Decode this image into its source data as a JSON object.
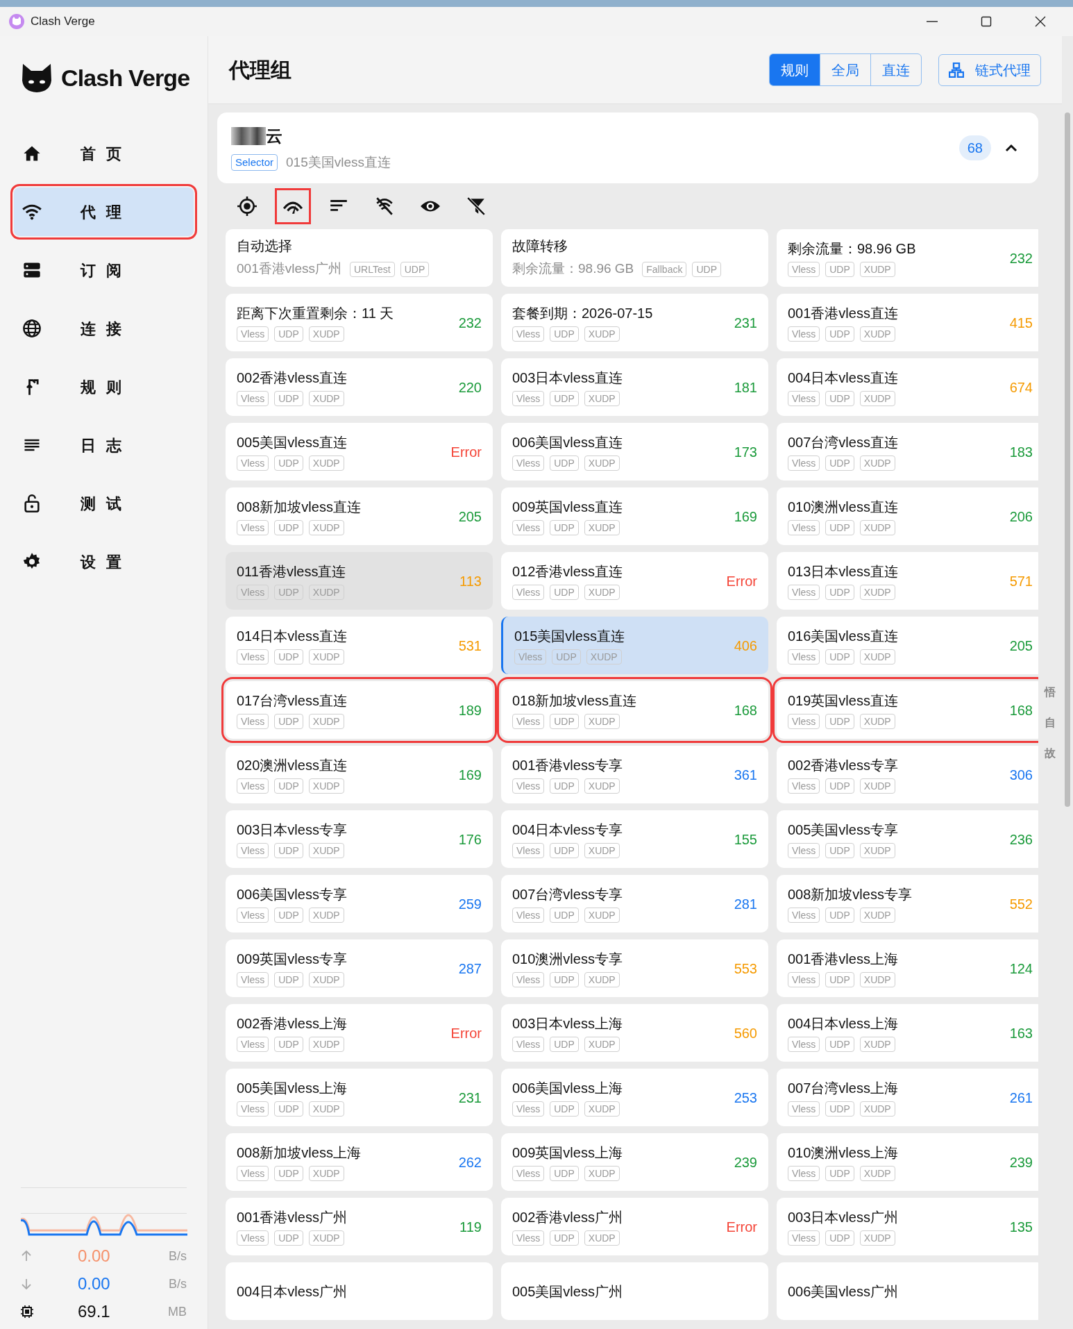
{
  "window": {
    "title": "Clash Verge"
  },
  "sidebar": {
    "logo": "Clash Verge",
    "items": [
      {
        "label": "首 页",
        "selected": false,
        "outlined": false
      },
      {
        "label": "代 理",
        "selected": true,
        "outlined": true
      },
      {
        "label": "订 阅",
        "selected": false,
        "outlined": false
      },
      {
        "label": "连 接",
        "selected": false,
        "outlined": false
      },
      {
        "label": "规 则",
        "selected": false,
        "outlined": false
      },
      {
        "label": "日 志",
        "selected": false,
        "outlined": false
      },
      {
        "label": "测 试",
        "selected": false,
        "outlined": false
      },
      {
        "label": "设 置",
        "selected": false,
        "outlined": false
      }
    ],
    "traffic": [
      {
        "kind": "up",
        "value": "0.00",
        "unit": "B/s"
      },
      {
        "kind": "down",
        "value": "0.00",
        "unit": "B/s"
      },
      {
        "kind": "memory",
        "value": "69.1",
        "unit": "MB"
      }
    ]
  },
  "header": {
    "title": "代理组",
    "modes": [
      {
        "label": "规则",
        "selected": true
      },
      {
        "label": "全局",
        "selected": false
      },
      {
        "label": "直连",
        "selected": false
      }
    ],
    "chain_button": "链式代理"
  },
  "group": {
    "title": "云",
    "type": "Selector",
    "current": "015美国vless直连",
    "count": "68",
    "expanded": true
  },
  "toolbar": [
    {
      "outlined": false
    },
    {
      "outlined": true
    },
    {
      "outlined": false
    },
    {
      "outlined": false
    },
    {
      "outlined": false
    },
    {
      "outlined": false
    }
  ],
  "proxies": [
    {
      "name": "自动选择",
      "subtitle": "001香港vless广州",
      "tags": [
        "URLTest",
        "UDP"
      ]
    },
    {
      "name": "故障转移",
      "subtitle": "剩余流量：98.96 GB",
      "tags": [
        "Fallback",
        "UDP"
      ]
    },
    {
      "name": "剩余流量：98.96 GB",
      "tags": [
        "Vless",
        "UDP",
        "XUDP"
      ],
      "delay": "232",
      "color": "#1a9a3a"
    },
    {
      "name": "距离下次重置剩余：11 天",
      "tags": [
        "Vless",
        "UDP",
        "XUDP"
      ],
      "delay": "232",
      "color": "#1a9a3a"
    },
    {
      "name": "套餐到期：2026-07-15",
      "tags": [
        "Vless",
        "UDP",
        "XUDP"
      ],
      "delay": "231",
      "color": "#1a9a3a"
    },
    {
      "name": "001香港vless直连",
      "tags": [
        "Vless",
        "UDP",
        "XUDP"
      ],
      "delay": "415",
      "color": "#f59a00"
    },
    {
      "name": "002香港vless直连",
      "tags": [
        "Vless",
        "UDP",
        "XUDP"
      ],
      "delay": "220",
      "color": "#1a9a3a"
    },
    {
      "name": "003日本vless直连",
      "tags": [
        "Vless",
        "UDP",
        "XUDP"
      ],
      "delay": "181",
      "color": "#1a9a3a"
    },
    {
      "name": "004日本vless直连",
      "tags": [
        "Vless",
        "UDP",
        "XUDP"
      ],
      "delay": "674",
      "color": "#f59a00"
    },
    {
      "name": "005美国vless直连",
      "tags": [
        "Vless",
        "UDP",
        "XUDP"
      ],
      "delay": "Error",
      "color": "#f44336"
    },
    {
      "name": "006美国vless直连",
      "tags": [
        "Vless",
        "UDP",
        "XUDP"
      ],
      "delay": "173",
      "color": "#1a9a3a"
    },
    {
      "name": "007台湾vless直连",
      "tags": [
        "Vless",
        "UDP",
        "XUDP"
      ],
      "delay": "183",
      "color": "#1a9a3a"
    },
    {
      "name": "008新加坡vless直连",
      "tags": [
        "Vless",
        "UDP",
        "XUDP"
      ],
      "delay": "205",
      "color": "#1a9a3a"
    },
    {
      "name": "009英国vless直连",
      "tags": [
        "Vless",
        "UDP",
        "XUDP"
      ],
      "delay": "169",
      "color": "#1a9a3a"
    },
    {
      "name": "010澳洲vless直连",
      "tags": [
        "Vless",
        "UDP",
        "XUDP"
      ],
      "delay": "206",
      "color": "#1a9a3a"
    },
    {
      "name": "011香港vless直连",
      "tags": [
        "Vless",
        "UDP",
        "XUDP"
      ],
      "delay": "113",
      "color": "#f59a00",
      "hovered": true
    },
    {
      "name": "012香港vless直连",
      "tags": [
        "Vless",
        "UDP",
        "XUDP"
      ],
      "delay": "Error",
      "color": "#f44336"
    },
    {
      "name": "013日本vless直连",
      "tags": [
        "Vless",
        "UDP",
        "XUDP"
      ],
      "delay": "571",
      "color": "#f59a00"
    },
    {
      "name": "014日本vless直连",
      "tags": [
        "Vless",
        "UDP",
        "XUDP"
      ],
      "delay": "531",
      "color": "#f59a00"
    },
    {
      "name": "015美国vless直连",
      "tags": [
        "Vless",
        "UDP",
        "XUDP"
      ],
      "delay": "406",
      "color": "#f59a00",
      "selected": true
    },
    {
      "name": "016美国vless直连",
      "tags": [
        "Vless",
        "UDP",
        "XUDP"
      ],
      "delay": "205",
      "color": "#1a9a3a"
    },
    {
      "name": "017台湾vless直连",
      "tags": [
        "Vless",
        "UDP",
        "XUDP"
      ],
      "delay": "189",
      "color": "#1a9a3a",
      "outlined": true
    },
    {
      "name": "018新加坡vless直连",
      "tags": [
        "Vless",
        "UDP",
        "XUDP"
      ],
      "delay": "168",
      "color": "#1a9a3a",
      "outlined": true
    },
    {
      "name": "019英国vless直连",
      "tags": [
        "Vless",
        "UDP",
        "XUDP"
      ],
      "delay": "168",
      "color": "#1a9a3a",
      "outlined": true
    },
    {
      "name": "020澳洲vless直连",
      "tags": [
        "Vless",
        "UDP",
        "XUDP"
      ],
      "delay": "169",
      "color": "#1a9a3a"
    },
    {
      "name": "001香港vless专享",
      "tags": [
        "Vless",
        "UDP",
        "XUDP"
      ],
      "delay": "361",
      "color": "#1976f0"
    },
    {
      "name": "002香港vless专享",
      "tags": [
        "Vless",
        "UDP",
        "XUDP"
      ],
      "delay": "306",
      "color": "#1976f0"
    },
    {
      "name": "003日本vless专享",
      "tags": [
        "Vless",
        "UDP",
        "XUDP"
      ],
      "delay": "176",
      "color": "#1a9a3a"
    },
    {
      "name": "004日本vless专享",
      "tags": [
        "Vless",
        "UDP",
        "XUDP"
      ],
      "delay": "155",
      "color": "#1a9a3a"
    },
    {
      "name": "005美国vless专享",
      "tags": [
        "Vless",
        "UDP",
        "XUDP"
      ],
      "delay": "236",
      "color": "#1a9a3a"
    },
    {
      "name": "006美国vless专享",
      "tags": [
        "Vless",
        "UDP",
        "XUDP"
      ],
      "delay": "259",
      "color": "#1976f0"
    },
    {
      "name": "007台湾vless专享",
      "tags": [
        "Vless",
        "UDP",
        "XUDP"
      ],
      "delay": "281",
      "color": "#1976f0"
    },
    {
      "name": "008新加坡vless专享",
      "tags": [
        "Vless",
        "UDP",
        "XUDP"
      ],
      "delay": "552",
      "color": "#f59a00"
    },
    {
      "name": "009英国vless专享",
      "tags": [
        "Vless",
        "UDP",
        "XUDP"
      ],
      "delay": "287",
      "color": "#1976f0"
    },
    {
      "name": "010澳洲vless专享",
      "tags": [
        "Vless",
        "UDP",
        "XUDP"
      ],
      "delay": "553",
      "color": "#f59a00"
    },
    {
      "name": "001香港vless上海",
      "tags": [
        "Vless",
        "UDP",
        "XUDP"
      ],
      "delay": "124",
      "color": "#1a9a3a"
    },
    {
      "name": "002香港vless上海",
      "tags": [
        "Vless",
        "UDP",
        "XUDP"
      ],
      "delay": "Error",
      "color": "#f44336"
    },
    {
      "name": "003日本vless上海",
      "tags": [
        "Vless",
        "UDP",
        "XUDP"
      ],
      "delay": "560",
      "color": "#f59a00"
    },
    {
      "name": "004日本vless上海",
      "tags": [
        "Vless",
        "UDP",
        "XUDP"
      ],
      "delay": "163",
      "color": "#1a9a3a"
    },
    {
      "name": "005美国vless上海",
      "tags": [
        "Vless",
        "UDP",
        "XUDP"
      ],
      "delay": "231",
      "color": "#1a9a3a"
    },
    {
      "name": "006美国vless上海",
      "tags": [
        "Vless",
        "UDP",
        "XUDP"
      ],
      "delay": "253",
      "color": "#1976f0"
    },
    {
      "name": "007台湾vless上海",
      "tags": [
        "Vless",
        "UDP",
        "XUDP"
      ],
      "delay": "261",
      "color": "#1976f0"
    },
    {
      "name": "008新加坡vless上海",
      "tags": [
        "Vless",
        "UDP",
        "XUDP"
      ],
      "delay": "262",
      "color": "#1976f0"
    },
    {
      "name": "009英国vless上海",
      "tags": [
        "Vless",
        "UDP",
        "XUDP"
      ],
      "delay": "239",
      "color": "#1a9a3a"
    },
    {
      "name": "010澳洲vless上海",
      "tags": [
        "Vless",
        "UDP",
        "XUDP"
      ],
      "delay": "239",
      "color": "#1a9a3a"
    },
    {
      "name": "001香港vless广州",
      "tags": [
        "Vless",
        "UDP",
        "XUDP"
      ],
      "delay": "119",
      "color": "#1a9a3a"
    },
    {
      "name": "002香港vless广州",
      "tags": [
        "Vless",
        "UDP",
        "XUDP"
      ],
      "delay": "Error",
      "color": "#f44336"
    },
    {
      "name": "003日本vless广州",
      "tags": [
        "Vless",
        "UDP",
        "XUDP"
      ],
      "delay": "135",
      "color": "#1a9a3a"
    },
    {
      "name": "004日本vless广州"
    },
    {
      "name": "005美国vless广州"
    },
    {
      "name": "006美国vless广州"
    }
  ],
  "background_window_text": [
    "悟",
    "自",
    "故"
  ]
}
